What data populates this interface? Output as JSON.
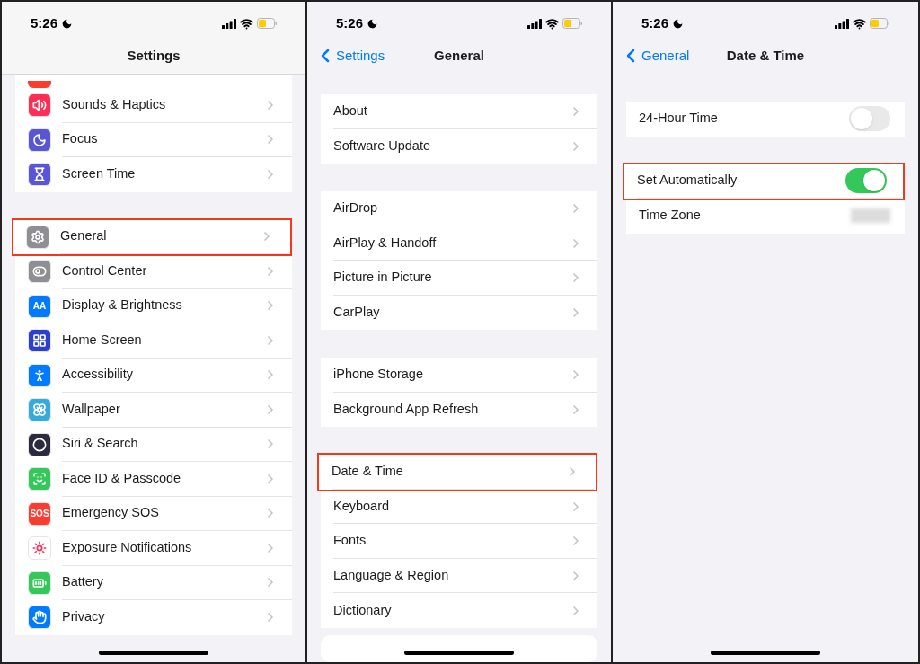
{
  "panels": [
    {
      "status": {
        "time": "5:26"
      },
      "nav": {
        "title": "Settings"
      },
      "groups": [
        {
          "rows": [
            {
              "label": "Sounds & Haptics",
              "kind": "link",
              "highlighted": false,
              "color": "#ff2d55"
            },
            {
              "label": "Focus",
              "kind": "link",
              "highlighted": false,
              "color": "#5856d6"
            },
            {
              "label": "Screen Time",
              "kind": "link",
              "highlighted": false,
              "color": "#5856d6"
            }
          ]
        },
        {
          "rows": [
            {
              "label": "General",
              "kind": "link",
              "highlighted": true,
              "color": "#8e8e93"
            },
            {
              "label": "Control Center",
              "kind": "link",
              "highlighted": false,
              "color": "#8e8e93"
            },
            {
              "label": "Display & Brightness",
              "kind": "link",
              "highlighted": false,
              "color": "#007aff",
              "icon_text": "AA"
            },
            {
              "label": "Home Screen",
              "kind": "link",
              "highlighted": false,
              "color": "#2b3fd0"
            },
            {
              "label": "Accessibility",
              "kind": "link",
              "highlighted": false,
              "color": "#007aff"
            },
            {
              "label": "Wallpaper",
              "kind": "link",
              "highlighted": false,
              "color": "#35aadc"
            },
            {
              "label": "Siri & Search",
              "kind": "link",
              "highlighted": false,
              "color": "#2a2a40"
            },
            {
              "label": "Face ID & Passcode",
              "kind": "link",
              "highlighted": false,
              "color": "#34c759"
            },
            {
              "label": "Emergency SOS",
              "kind": "link",
              "highlighted": false,
              "color": "#ff3b30",
              "icon_text": "SOS"
            },
            {
              "label": "Exposure Notifications",
              "kind": "link",
              "highlighted": false,
              "color": "#ffffff"
            },
            {
              "label": "Battery",
              "kind": "link",
              "highlighted": false,
              "color": "#34c759"
            },
            {
              "label": "Privacy",
              "kind": "link",
              "highlighted": false,
              "color": "#007aff"
            }
          ]
        }
      ]
    },
    {
      "status": {
        "time": "5:26"
      },
      "nav": {
        "title": "General",
        "back": "Settings"
      },
      "groups": [
        {
          "rows": [
            {
              "label": "About",
              "kind": "link",
              "highlighted": false
            },
            {
              "label": "Software Update",
              "kind": "link",
              "highlighted": false
            }
          ]
        },
        {
          "rows": [
            {
              "label": "AirDrop",
              "kind": "link",
              "highlighted": false
            },
            {
              "label": "AirPlay & Handoff",
              "kind": "link",
              "highlighted": false
            },
            {
              "label": "Picture in Picture",
              "kind": "link",
              "highlighted": false
            },
            {
              "label": "CarPlay",
              "kind": "link",
              "highlighted": false
            }
          ]
        },
        {
          "rows": [
            {
              "label": "iPhone Storage",
              "kind": "link",
              "highlighted": false
            },
            {
              "label": "Background App Refresh",
              "kind": "link",
              "highlighted": false
            }
          ]
        },
        {
          "rows": [
            {
              "label": "Date & Time",
              "kind": "link",
              "highlighted": true
            },
            {
              "label": "Keyboard",
              "kind": "link",
              "highlighted": false
            },
            {
              "label": "Fonts",
              "kind": "link",
              "highlighted": false
            },
            {
              "label": "Language & Region",
              "kind": "link",
              "highlighted": false
            },
            {
              "label": "Dictionary",
              "kind": "link",
              "highlighted": false
            }
          ]
        }
      ]
    },
    {
      "status": {
        "time": "5:26"
      },
      "nav": {
        "title": "Date & Time",
        "back": "General"
      },
      "groups": [
        {
          "rows": [
            {
              "label": "24-Hour Time",
              "kind": "toggle",
              "highlighted": false,
              "on": false
            }
          ]
        },
        {
          "rows": [
            {
              "label": "Set Automatically",
              "kind": "toggle",
              "highlighted": true,
              "on": true
            },
            {
              "label": "Time Zone",
              "kind": "blurred",
              "highlighted": false
            }
          ]
        }
      ]
    }
  ]
}
